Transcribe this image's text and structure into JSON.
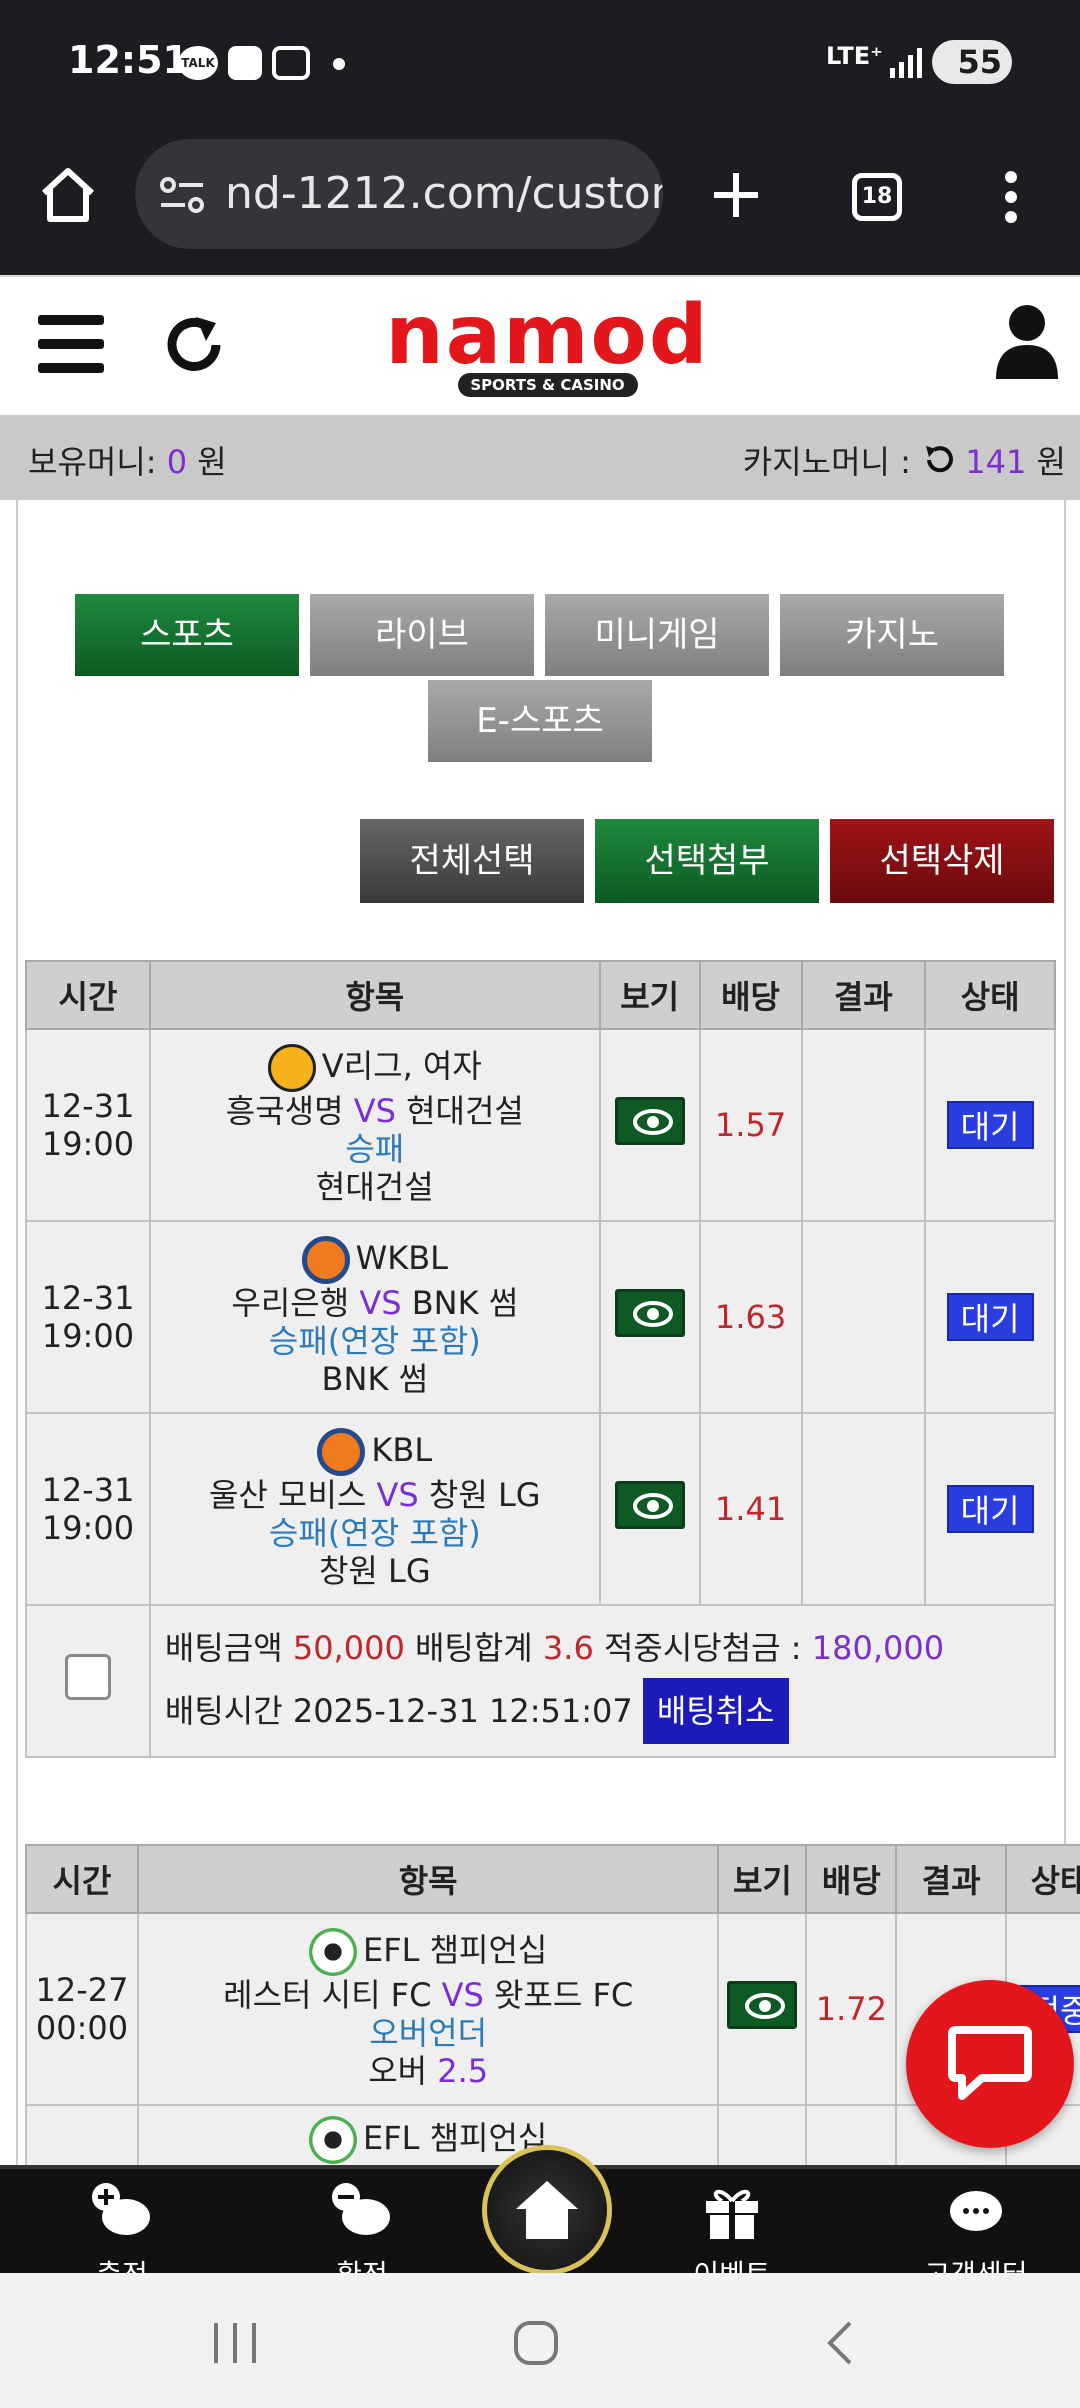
{
  "status_bar": {
    "time": "12:51",
    "talk_label": "TALK",
    "network": "LTE⁺",
    "battery": "55"
  },
  "browser": {
    "url": "nd-1212.com/custom",
    "tab_count": "18"
  },
  "header": {
    "logo_text": "namod",
    "logo_sub": "SPORTS & CASINO"
  },
  "money": {
    "holding_label": "보유머니:",
    "holding_value": "0",
    "holding_unit": "원",
    "casino_label": "카지노머니 :",
    "casino_value": "141",
    "casino_unit": "원"
  },
  "categories": [
    {
      "label": "스포츠",
      "active": true
    },
    {
      "label": "라이브",
      "active": false
    },
    {
      "label": "미니게임",
      "active": false
    },
    {
      "label": "카지노",
      "active": false
    },
    {
      "label": "E-스포츠",
      "active": false
    }
  ],
  "actions": {
    "select_all": "전체선택",
    "attach": "선택첨부",
    "delete": "선택삭제"
  },
  "table_headers": [
    "시간",
    "항목",
    "보기",
    "배당",
    "결과",
    "상태"
  ],
  "bet1": {
    "rows": [
      {
        "date": "12-31",
        "time": "19:00",
        "sport": "volleyball",
        "league": "V리그, 여자",
        "home": "흥국생명",
        "vs": "VS",
        "away": "현대건설",
        "market": "승패",
        "pick": "현대건설",
        "odds": "1.57",
        "result": "",
        "status": "대기"
      },
      {
        "date": "12-31",
        "time": "19:00",
        "sport": "basketball",
        "league": "WKBL",
        "home": "우리은행",
        "vs": "VS",
        "away": "BNK 썸",
        "market": "승패(연장 포함)",
        "pick": "BNK 썸",
        "odds": "1.63",
        "result": "",
        "status": "대기"
      },
      {
        "date": "12-31",
        "time": "19:00",
        "sport": "basketball",
        "league": "KBL",
        "home": "울산 모비스",
        "vs": "VS",
        "away": "창원 LG",
        "market": "승패(연장 포함)",
        "pick": "창원 LG",
        "odds": "1.41",
        "result": "",
        "status": "대기"
      }
    ],
    "summary": {
      "amount_label": "배팅금액",
      "amount": "50,000",
      "total_odds_label": "배팅합계",
      "total_odds": "3.6",
      "win_label": "적중시당첨금 :",
      "win": "180,000",
      "time_label": "배팅시간",
      "time": "2025-12-31 12:51:07",
      "cancel": "배팅취소"
    }
  },
  "bet2": {
    "rows": [
      {
        "date": "12-27",
        "time": "00:00",
        "sport": "soccer",
        "league": "EFL 챔피언십",
        "home": "레스터 시티 FC",
        "vs": "VS",
        "away": "왓포드 FC",
        "market": "오버언더",
        "pick": "오버",
        "pick_value": "2.5",
        "odds": "1.72",
        "result": "",
        "status": "적중"
      },
      {
        "sport": "soccer",
        "league": "EFL 챔피언십"
      }
    ]
  },
  "bottom_nav": [
    {
      "label": "충전",
      "icon": "piggy-plus-icon"
    },
    {
      "label": "환전",
      "icon": "piggy-minus-icon"
    },
    {
      "label": "",
      "icon": "home-icon"
    },
    {
      "label": "이벤트",
      "icon": "gift-icon"
    },
    {
      "label": "고객센터",
      "icon": "support-chat-icon"
    }
  ]
}
